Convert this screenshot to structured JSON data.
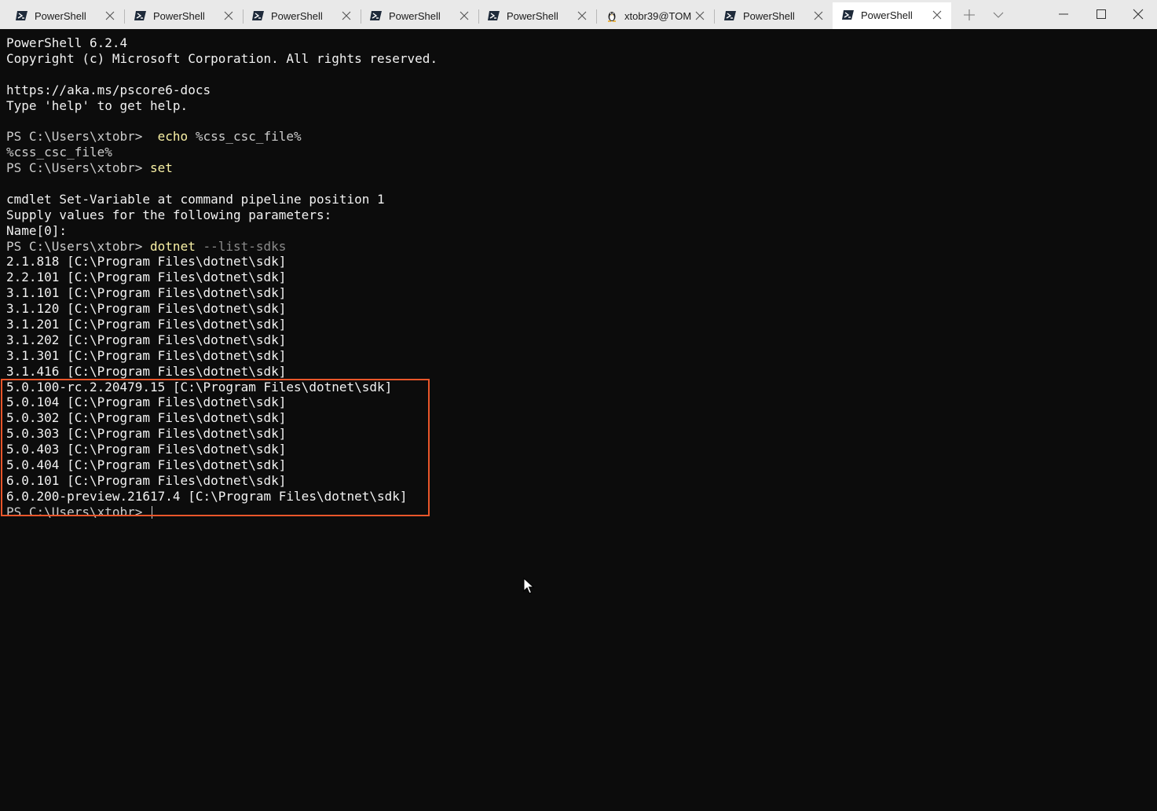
{
  "tabs": [
    {
      "label": "PowerShell",
      "icon": "powershell-icon",
      "active": false
    },
    {
      "label": "PowerShell",
      "icon": "powershell-icon",
      "active": false
    },
    {
      "label": "PowerShell",
      "icon": "powershell-icon",
      "active": false
    },
    {
      "label": "PowerShell",
      "icon": "powershell-icon",
      "active": false
    },
    {
      "label": "PowerShell",
      "icon": "powershell-icon",
      "active": false
    },
    {
      "label": "xtobr39@TOM",
      "icon": "linux-penguin-icon",
      "active": false
    },
    {
      "label": "PowerShell",
      "icon": "powershell-icon",
      "active": false
    },
    {
      "label": "PowerShell",
      "icon": "powershell-icon",
      "active": true
    }
  ],
  "terminal": {
    "banner": {
      "version": "PowerShell 6.2.4",
      "copyright": "Copyright (c) Microsoft Corporation. All rights reserved.",
      "docs_url": "https://aka.ms/pscore6-docs",
      "help_hint": "Type 'help' to get help."
    },
    "prompt": "PS C:\\Users\\xtobr>",
    "cmd_echo": {
      "command": "echo",
      "args": "%css_csc_file%",
      "output": "%css_csc_file%"
    },
    "cmd_set": {
      "command": "set"
    },
    "set_output": {
      "line1": "cmdlet Set-Variable at command pipeline position 1",
      "line2": "Supply values for the following parameters:",
      "line3": "Name[0]:"
    },
    "cmd_dotnet": {
      "command": "dotnet",
      "args": "--list-sdks"
    },
    "sdk_list": [
      "2.1.818 [C:\\Program Files\\dotnet\\sdk]",
      "2.2.101 [C:\\Program Files\\dotnet\\sdk]",
      "3.1.101 [C:\\Program Files\\dotnet\\sdk]",
      "3.1.120 [C:\\Program Files\\dotnet\\sdk]",
      "3.1.201 [C:\\Program Files\\dotnet\\sdk]",
      "3.1.202 [C:\\Program Files\\dotnet\\sdk]",
      "3.1.301 [C:\\Program Files\\dotnet\\sdk]",
      "3.1.416 [C:\\Program Files\\dotnet\\sdk]",
      "5.0.100-rc.2.20479.15 [C:\\Program Files\\dotnet\\sdk]",
      "5.0.104 [C:\\Program Files\\dotnet\\sdk]",
      "5.0.302 [C:\\Program Files\\dotnet\\sdk]",
      "5.0.303 [C:\\Program Files\\dotnet\\sdk]",
      "5.0.403 [C:\\Program Files\\dotnet\\sdk]",
      "5.0.404 [C:\\Program Files\\dotnet\\sdk]",
      "6.0.101 [C:\\Program Files\\dotnet\\sdk]",
      "6.0.200-preview.21617.4 [C:\\Program Files\\dotnet\\sdk]"
    ]
  },
  "colors": {
    "background": "#0c0c0c",
    "text": "#cccccc",
    "command": "#f9f1a5",
    "argument": "#8a8a8a",
    "highlight_border": "#e9562a",
    "tabbar": "#e9e9e9"
  }
}
